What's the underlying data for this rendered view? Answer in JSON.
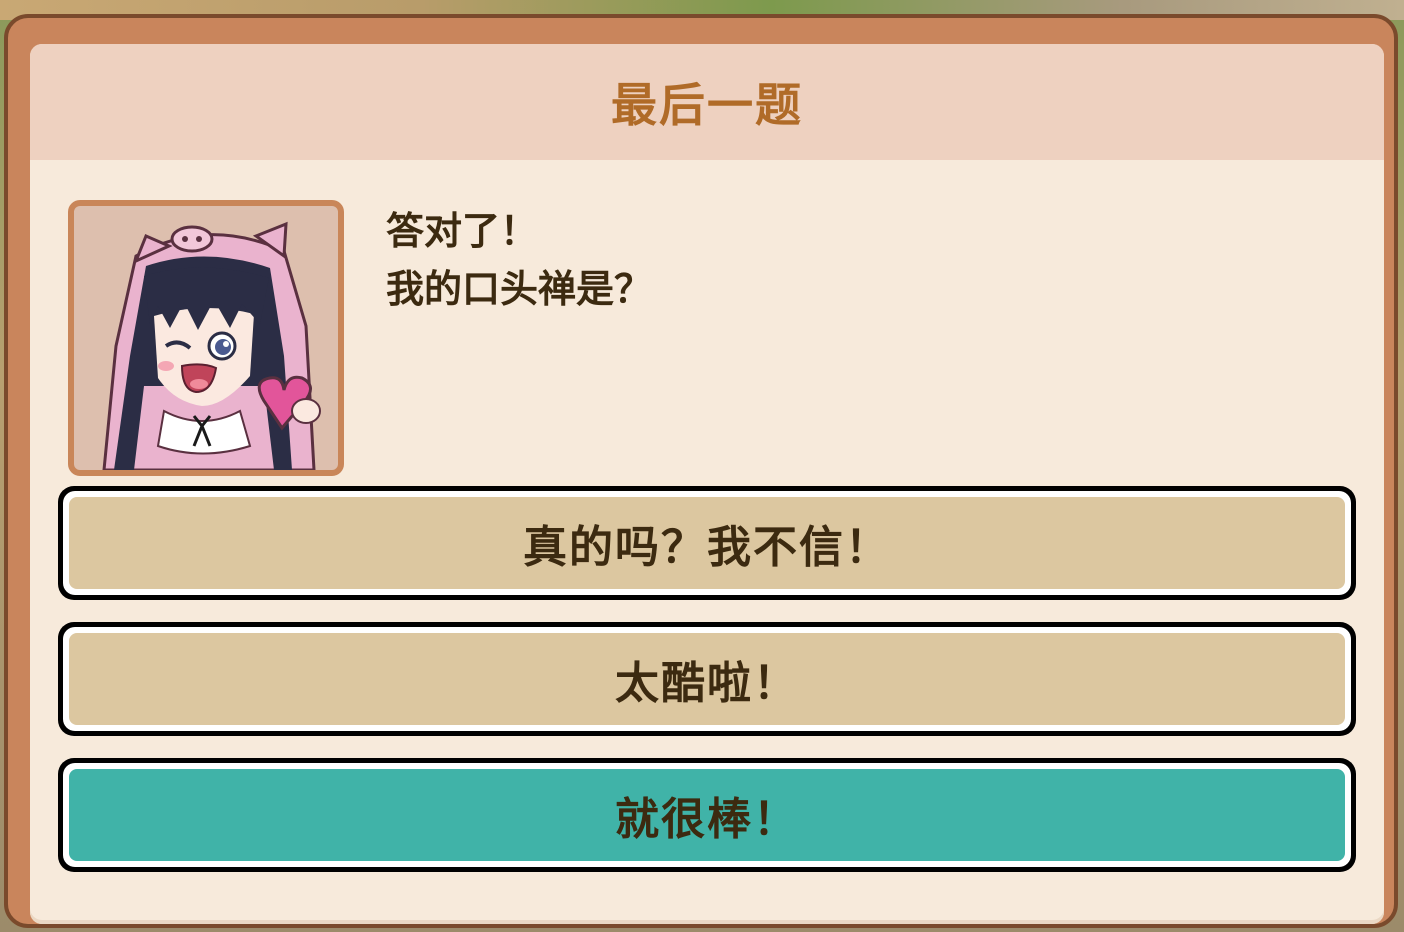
{
  "dialog": {
    "title": "最后一题",
    "line1": "答对了！",
    "line2": "我的口头禅是？"
  },
  "choices": [
    {
      "label": "真的吗？我不信！",
      "color": "#dcc7a0"
    },
    {
      "label": "太酷啦！",
      "color": "#dcc7a0"
    },
    {
      "label": "就很棒！",
      "color": "#40b3a8"
    }
  ],
  "colors": {
    "frame": "#c9855c",
    "panel": "#f7eadb",
    "title_bar": "#eed1c0",
    "title_text": "#b06b28",
    "text": "#3c2a10",
    "selected": "#40b3a8"
  },
  "portrait": {
    "icon": "girl-with-pink-pig-hood-portrait"
  }
}
